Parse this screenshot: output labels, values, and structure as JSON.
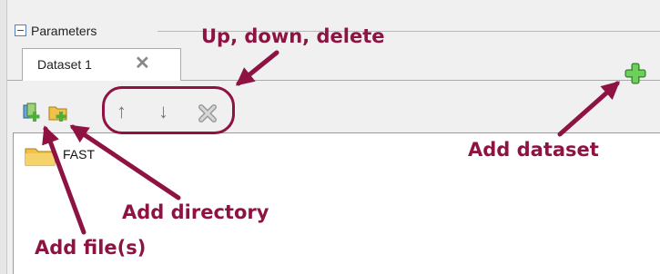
{
  "group": {
    "title": "Parameters",
    "collapse_icon": "minus-box-icon"
  },
  "tabs": [
    {
      "label": "Dataset 1",
      "close_icon": "close-x-icon"
    }
  ],
  "toolbar": {
    "add_file_icon": "add-file-icon",
    "add_directory_icon": "add-folder-icon",
    "up": "↑",
    "down": "↓",
    "delete_icon": "delete-x-icon",
    "add_dataset_icon": "green-plus-icon"
  },
  "list": {
    "items": [
      {
        "icon": "folder-icon",
        "label": "FAST"
      }
    ]
  },
  "annotations": {
    "up_down_delete": "Up, down, delete",
    "add_dataset": "Add dataset",
    "add_directory": "Add directory",
    "add_files": "Add file(s)"
  },
  "colors": {
    "annotation": "#8e1343",
    "plus_green": "#4caf3a",
    "folder": "#f0c14b"
  }
}
